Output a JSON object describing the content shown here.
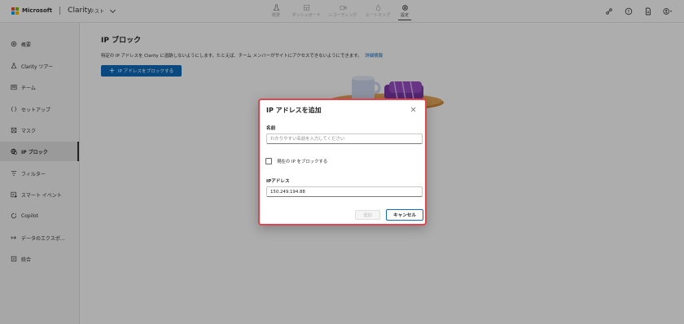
{
  "brand": {
    "company": "Microsoft",
    "product": "Clarity"
  },
  "project": {
    "name": "テスト"
  },
  "topnav": [
    {
      "label": "概要",
      "icon": "flask-icon",
      "active": false
    },
    {
      "label": "ダッシュボード",
      "icon": "dashboard-icon",
      "active": false
    },
    {
      "label": "レコーディング",
      "icon": "video-icon",
      "active": false
    },
    {
      "label": "ヒートマップ",
      "icon": "flame-icon",
      "active": false
    },
    {
      "label": "設定",
      "icon": "gear-icon",
      "active": true
    }
  ],
  "topicons": [
    "share-icon",
    "help-icon",
    "document-icon",
    "account-icon"
  ],
  "sidebar": {
    "items": [
      {
        "label": "概要",
        "icon": "gear-icon"
      },
      {
        "label": "Clarity ツアー",
        "icon": "flask-icon"
      },
      {
        "label": "チーム",
        "icon": "team-icon"
      },
      {
        "label": "セットアップ",
        "icon": "braces-icon"
      },
      {
        "label": "マスク",
        "icon": "mask-icon"
      },
      {
        "label": "IP ブロック",
        "icon": "ip-block-icon",
        "active": true
      },
      {
        "label": "フィルター",
        "icon": "filter-icon"
      },
      {
        "label": "スマート イベント",
        "icon": "smart-event-icon"
      },
      {
        "label": "Copilot",
        "icon": "copilot-icon"
      },
      {
        "label": "データのエクスポ...",
        "icon": "export-icon"
      },
      {
        "label": "統合",
        "icon": "integration-icon"
      }
    ]
  },
  "main": {
    "title": "IP ブロック",
    "description": "特定の IP アドレスを Clarity に追跡しないようにします。たとえば、チーム メンバーがサイトにアクセスできないようにできます。",
    "learn_more": "詳細情報",
    "block_button": "IP アドレスをブロックする"
  },
  "dialog": {
    "title": "IP アドレスを追加",
    "name_label": "名前",
    "name_placeholder": "わかりやすい名前を入力してください",
    "name_value": "",
    "checkbox_label": "現在の IP をブロックする",
    "checkbox_checked": false,
    "ip_label": "IPアドレス",
    "ip_value": "150.249.194.88",
    "add_button": "追加",
    "cancel_button": "キャンセル"
  },
  "colors": {
    "primary": "#0f6cbd",
    "highlight": "#e0464f"
  }
}
